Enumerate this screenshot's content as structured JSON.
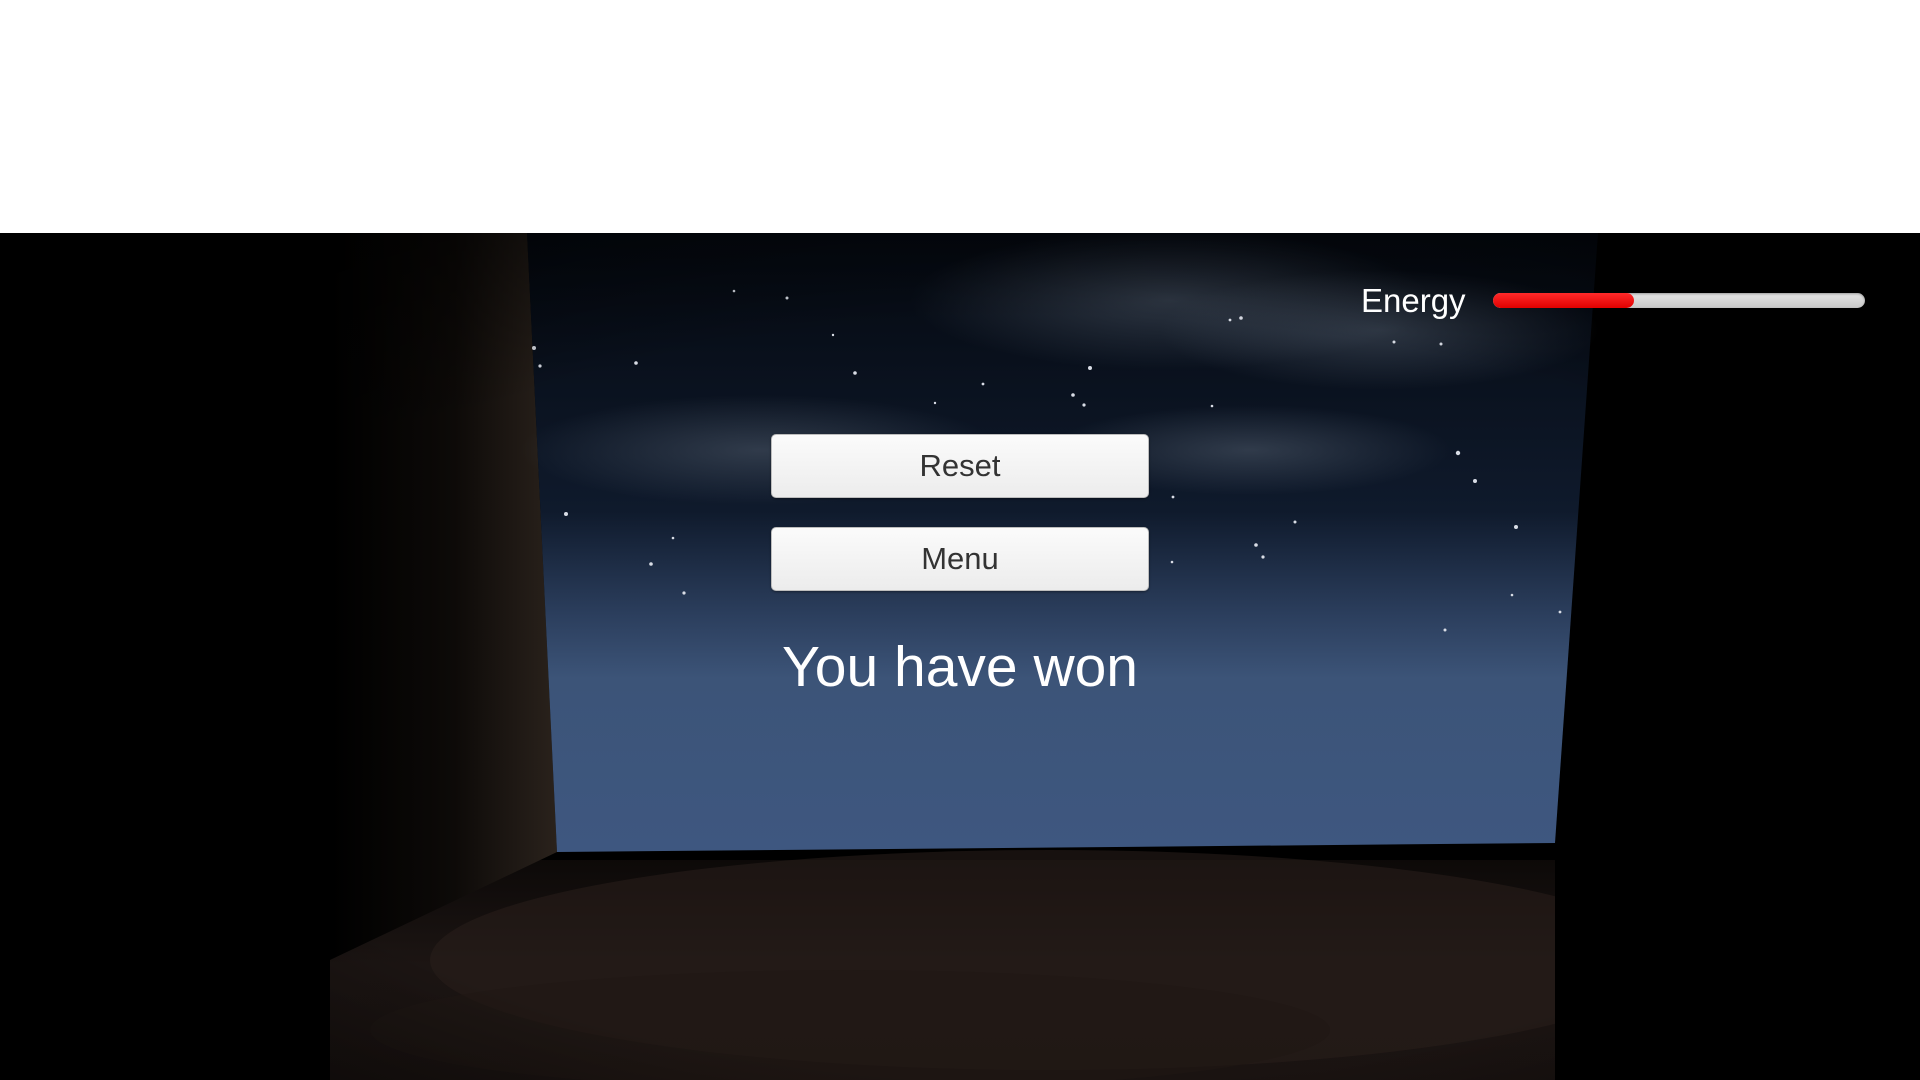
{
  "hud": {
    "energy_label": "Energy",
    "energy_level": 0.38,
    "energy_fill_color": "#ff0000",
    "energy_track_color": "#d9d9d9"
  },
  "menu": {
    "reset_label": "Reset",
    "menu_label": "Menu"
  },
  "message": {
    "result_text": "You have won"
  },
  "scene": {
    "sky_top_color": "#050a16",
    "sky_horizon_color": "#3c5478",
    "ground_color": "#1a1412"
  }
}
